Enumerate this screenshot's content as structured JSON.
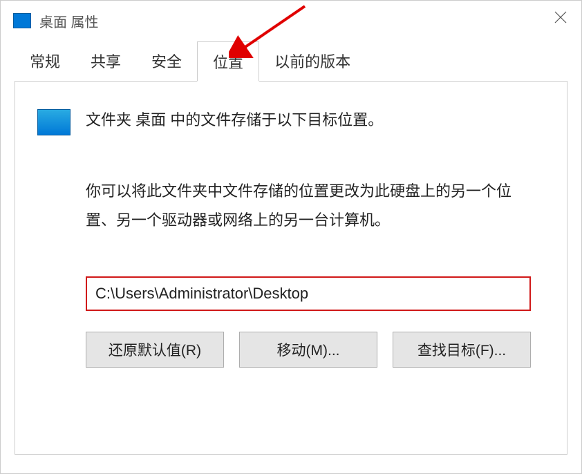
{
  "titlebar": {
    "title": "桌面 属性"
  },
  "tabs": {
    "items": [
      {
        "label": "常规"
      },
      {
        "label": "共享"
      },
      {
        "label": "安全"
      },
      {
        "label": "位置"
      },
      {
        "label": "以前的版本"
      }
    ],
    "active_index": 3
  },
  "content": {
    "info_text": "文件夹 桌面 中的文件存储于以下目标位置。",
    "description": "你可以将此文件夹中文件存储的位置更改为此硬盘上的另一个位置、另一个驱动器或网络上的另一台计算机。",
    "path_value": "C:\\Users\\Administrator\\Desktop"
  },
  "buttons": {
    "restore": "还原默认值(R)",
    "move": "移动(M)...",
    "find": "查找目标(F)..."
  }
}
